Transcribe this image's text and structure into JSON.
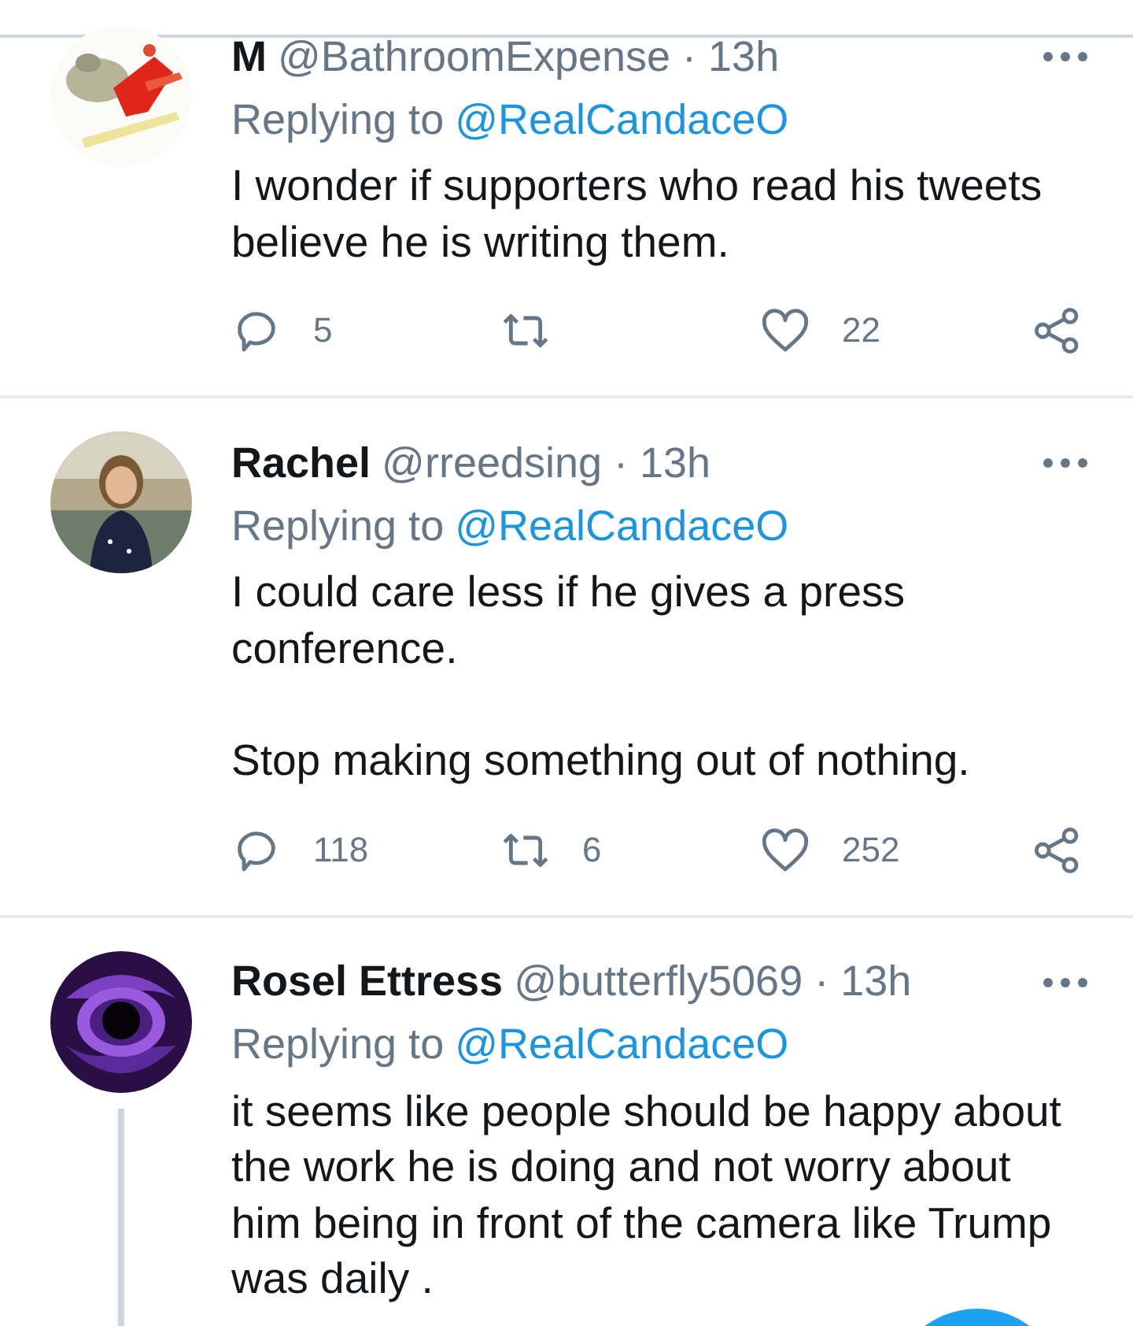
{
  "tweets": [
    {
      "avatar": {
        "kind": "picture"
      },
      "name": "M",
      "meta": "@BathroomExpense · 13h",
      "replying_label": "Replying to",
      "replying_to": "@RealCandaceO",
      "paragraphs": [
        "I wonder if supporters who read his tweets believe he is writing them."
      ],
      "actions": {
        "replies": "5",
        "likes": "22"
      },
      "thread_line": false
    },
    {
      "avatar": {
        "kind": "picture"
      },
      "name": "Rachel",
      "meta": "@rreedsing · 13h",
      "replying_label": "Replying to",
      "replying_to": "@RealCandaceO",
      "paragraphs": [
        "I could care less if he gives a press conference.",
        "Stop making something out of nothing."
      ],
      "actions": {
        "replies": "118",
        "retweets": "6",
        "likes": "252"
      },
      "thread_line": false
    },
    {
      "avatar": {
        "kind": "picture"
      },
      "name": "Rosel Ettress",
      "meta": "@butterfly5069 · 13h",
      "replying_label": "Replying to",
      "replying_to": "@RealCandaceO",
      "paragraphs": [
        "it seems like people should be happy about the work he is doing and not worry about him being in front of the camera like Trump was daily ."
      ],
      "thread_line": true
    }
  ]
}
